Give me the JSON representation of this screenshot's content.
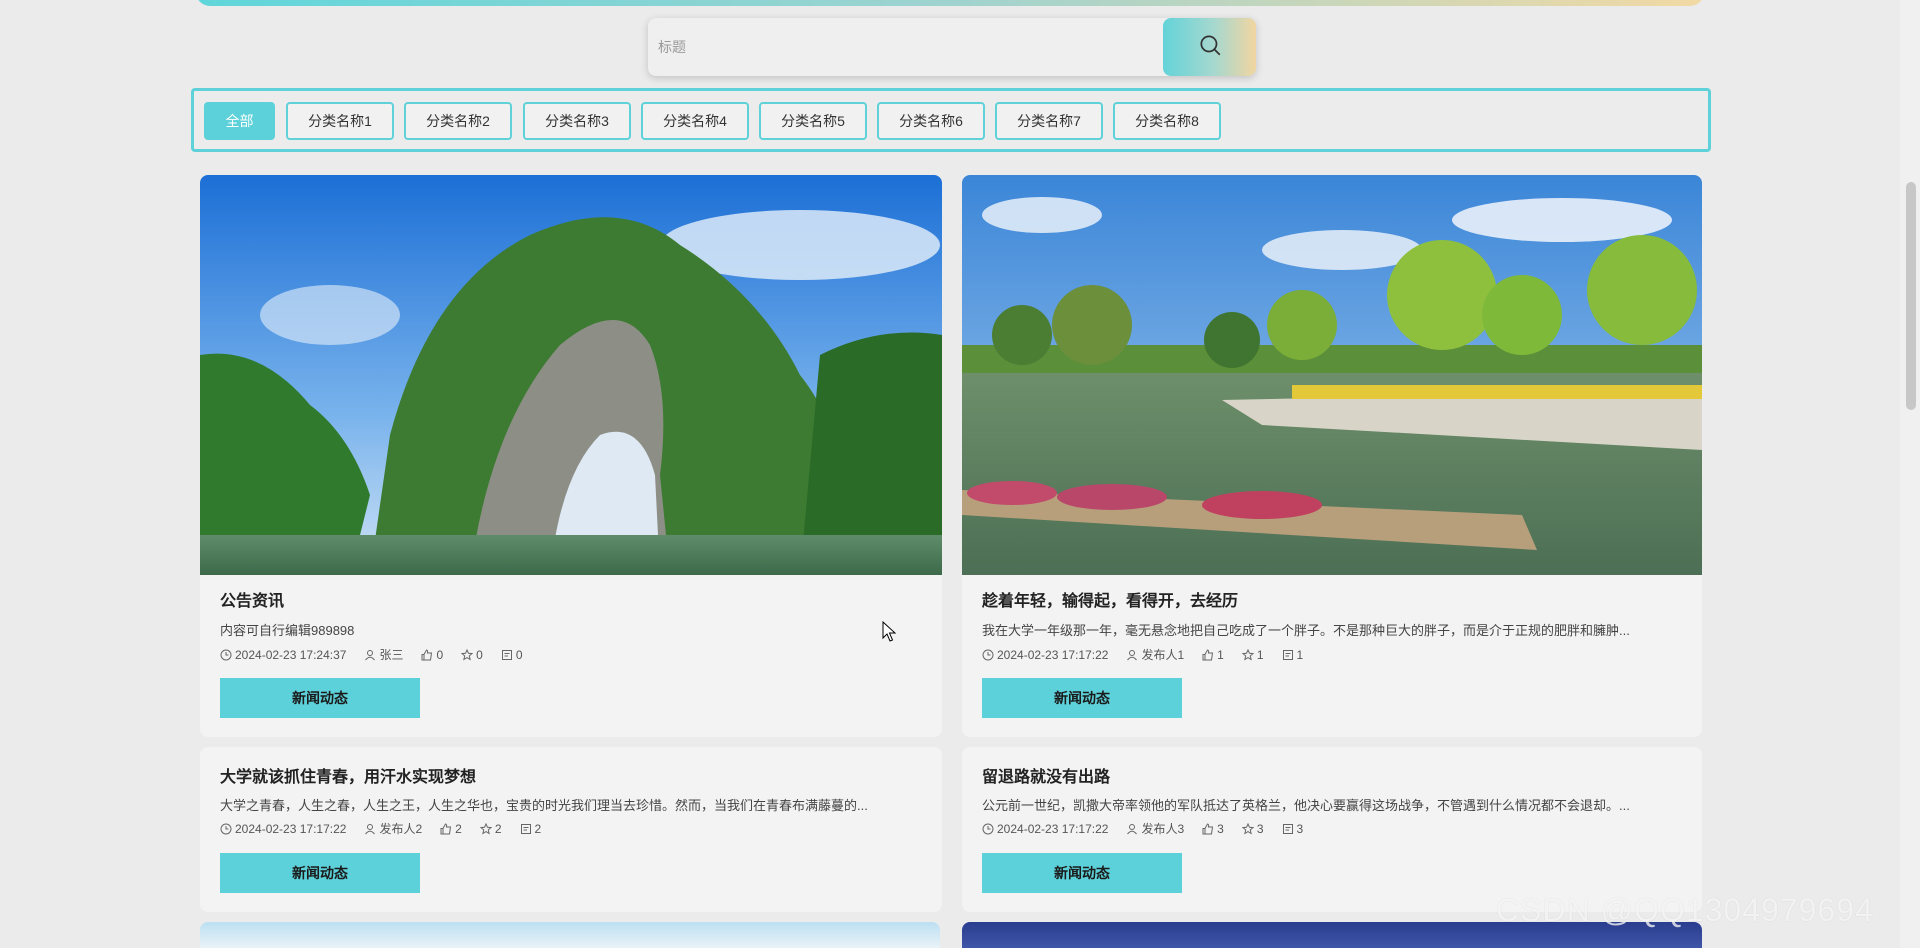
{
  "search": {
    "placeholder": "标题",
    "icon": "search-icon"
  },
  "categories": [
    "全部",
    "分类名称1",
    "分类名称2",
    "分类名称3",
    "分类名称4",
    "分类名称5",
    "分类名称6",
    "分类名称7",
    "分类名称8"
  ],
  "active_category": "全部",
  "colors": {
    "accent": "#5dd1d9",
    "gradient_end": "#f1d5a0"
  },
  "cards": [
    {
      "image": "karst-arch-mountain-over-river",
      "title": "公告资讯",
      "desc": "内容可自行编辑989898",
      "date": "2024-02-23 17:24:37",
      "author": "张三",
      "likes": "0",
      "favorites": "0",
      "comments": "0",
      "button": "新闻动态"
    },
    {
      "image": "park-pond-with-flower-raft-and-willows",
      "title": "趁着年轻，输得起，看得开，去经历",
      "desc": "我在大学一年级那一年，毫无悬念地把自己吃成了一个胖子。不是那种巨大的胖子，而是介于正规的肥胖和臃肿...",
      "date": "2024-02-23 17:17:22",
      "author": "发布人1",
      "likes": "1",
      "favorites": "1",
      "comments": "1",
      "button": "新闻动态"
    },
    {
      "title": "大学就该抓住青春，用汗水实现梦想",
      "desc": "大学之青春，人生之春，人生之王，人生之华也，宝贵的时光我们理当去珍惜。然而，当我们在青春布满藤蔓的...",
      "date": "2024-02-23 17:17:22",
      "author": "发布人2",
      "likes": "2",
      "favorites": "2",
      "comments": "2",
      "button": "新闻动态"
    },
    {
      "title": "留退路就没有出路",
      "desc": "公元前一世纪，凯撒大帝率领他的军队抵达了英格兰，他决心要赢得这场战争，不管遇到什么情况都不会退却。...",
      "date": "2024-02-23 17:17:22",
      "author": "发布人3",
      "likes": "3",
      "favorites": "3",
      "comments": "3",
      "button": "新闻动态"
    }
  ],
  "watermark": "CSDN @QQ1304979694"
}
